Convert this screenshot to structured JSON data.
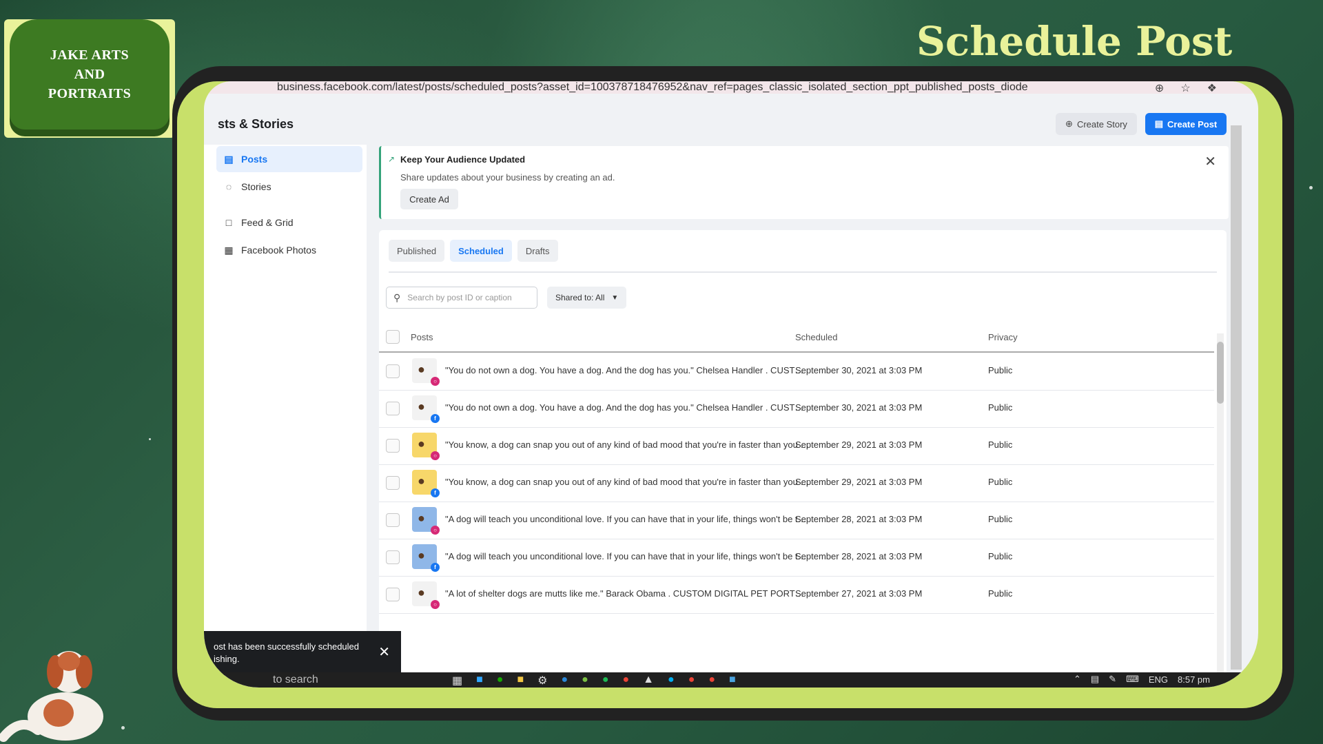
{
  "logo": {
    "text": "JAKE ARTS\nAND\nPORTRAITS"
  },
  "slide_title": "Schedule Post",
  "browser": {
    "url": "business.facebook.com/latest/posts/scheduled_posts?asset_id=100378718476952&nav_ref=pages_classic_isolated_section_ppt_published_posts_diode"
  },
  "header": {
    "title": "sts & Stories",
    "create_story": "Create Story",
    "create_post": "Create Post"
  },
  "sidebar": {
    "items": [
      {
        "label": "Posts",
        "icon": "posts-icon"
      },
      {
        "label": "Stories",
        "icon": "stories-icon"
      },
      {
        "label": "Feed & Grid",
        "icon": "grid-icon"
      },
      {
        "label": "Facebook Photos",
        "icon": "photos-icon"
      }
    ]
  },
  "banner": {
    "title": "Keep Your Audience Updated",
    "text": "Share updates about your business by creating an ad.",
    "button": "Create Ad"
  },
  "tabs": [
    "Published",
    "Scheduled",
    "Drafts"
  ],
  "filters": {
    "search_placeholder": "Search by post ID or caption",
    "shared": "Shared to: All"
  },
  "table": {
    "columns": [
      "Posts",
      "Scheduled",
      "Privacy"
    ],
    "rows": [
      {
        "caption": "\"You do not own a dog. You have a dog. And the dog has you.\" Chelsea Handler . CUSTOM DIGITAL PE...",
        "scheduled": "September 30, 2021 at 3:03 PM",
        "privacy": "Public",
        "platform": "instagram",
        "thumb": "white"
      },
      {
        "caption": "\"You do not own a dog. You have a dog. And the dog has you.\" Chelsea Handler . CUSTOM DIGITAL PE...",
        "scheduled": "September 30, 2021 at 3:03 PM",
        "privacy": "Public",
        "platform": "facebook",
        "thumb": "white"
      },
      {
        "caption": "\"You know, a dog can snap you out of any kind of bad mood that you're in faster than you can think of.\"...",
        "scheduled": "September 29, 2021 at 3:03 PM",
        "privacy": "Public",
        "platform": "instagram",
        "thumb": "yellow"
      },
      {
        "caption": "\"You know, a dog can snap you out of any kind of bad mood that you're in faster than you can think of.\"...",
        "scheduled": "September 29, 2021 at 3:03 PM",
        "privacy": "Public",
        "platform": "facebook",
        "thumb": "yellow"
      },
      {
        "caption": "\"A dog will teach you unconditional love. If you can have that in your life, things won't be too bad.\" Robe...",
        "scheduled": "September 28, 2021 at 3:03 PM",
        "privacy": "Public",
        "platform": "instagram",
        "thumb": "blue"
      },
      {
        "caption": "\"A dog will teach you unconditional love. If you can have that in your life, things won't be too bad.\" Robe...",
        "scheduled": "September 28, 2021 at 3:03 PM",
        "privacy": "Public",
        "platform": "facebook",
        "thumb": "blue"
      },
      {
        "caption": "\"A lot of shelter dogs are mutts like me.\" Barack Obama . CUSTOM DIGITAL PET PORTRAITS BY: @jake...",
        "scheduled": "September 27, 2021 at 3:03 PM",
        "privacy": "Public",
        "platform": "instagram",
        "thumb": "white"
      }
    ]
  },
  "toast": {
    "text": "ost has been successfully scheduled\nishing."
  },
  "taskbar": {
    "search": "to search",
    "lang": "ENG",
    "time": "8:57 pm"
  },
  "colors": {
    "accent": "#1877f2",
    "lime": "#c8e06a",
    "logo_green": "#3d7a22",
    "title": "#e9f29a"
  }
}
